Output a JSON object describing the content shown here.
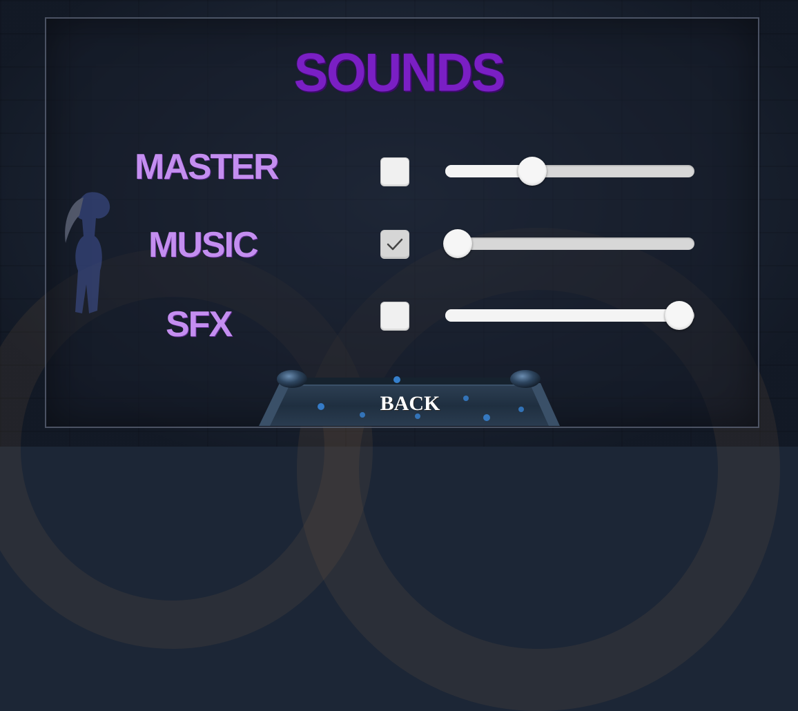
{
  "screen": {
    "title": "SOUNDS"
  },
  "settings": [
    {
      "label": "MASTER",
      "checked": false,
      "value": 0.35
    },
    {
      "label": "MUSIC",
      "checked": true,
      "value": 0.05
    },
    {
      "label": "SFX",
      "checked": false,
      "value": 0.94
    }
  ],
  "footer": {
    "back_label": "BACK"
  },
  "colors": {
    "title": "#7a1fc4",
    "labels": "#c48ef0",
    "background": "#1d2738"
  },
  "icons": {
    "check": "checkmark-icon"
  }
}
